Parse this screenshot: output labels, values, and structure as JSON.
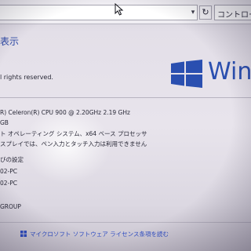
{
  "address_bar": {
    "dropdown_icon": "chevron-down-icon",
    "refresh_glyph": "↻",
    "search_placeholder": "コントロール パ"
  },
  "header": {
    "title": "表示"
  },
  "copyright": {
    "text": "l rights reserved."
  },
  "logo": {
    "text": "Win",
    "color": "#2a4fb0"
  },
  "system": {
    "processor": "R) Celeron(R) CPU      900  @ 2.20GHz   2.19 GHz",
    "memory": "GB",
    "system_type": "ト オペレーティング システム、x64 ベース プロセッサ",
    "pen_touch": "スプレイでは、ペン入力とタッチ入力は利用できません"
  },
  "computer_name": {
    "heading": "びの設定",
    "name": "02-PC",
    "full_name": "02-PC",
    "workgroup": "GROUP"
  },
  "activation": {
    "link": "マイクロソフト ソフトウェア ライセンス条項を読む"
  },
  "colors": {
    "accent": "#2f4aa6",
    "link": "#2f4ec4",
    "background": "#e8e4ec"
  }
}
